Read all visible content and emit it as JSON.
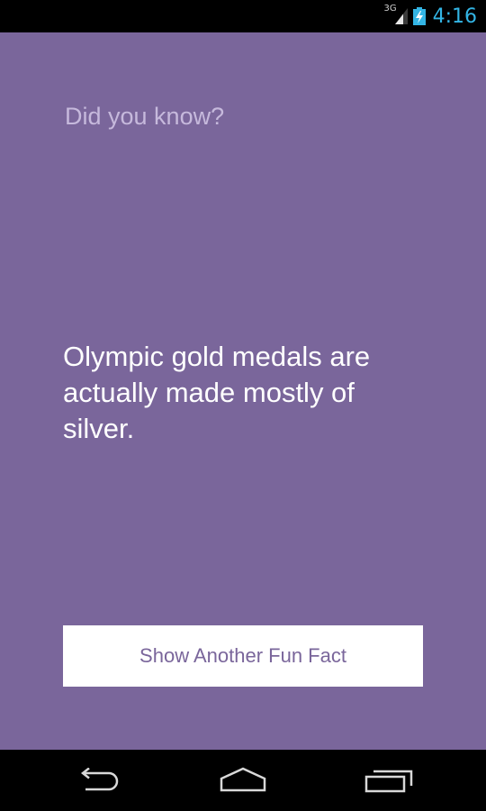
{
  "status_bar": {
    "network_type": "3G",
    "time": "4:16",
    "icons": [
      "signal-icon",
      "battery-charging-icon"
    ],
    "time_color": "#33b5e5"
  },
  "main": {
    "headline": "Did you know?",
    "fact_text": "Olympic gold medals are actually made mostly of silver.",
    "button_label": "Show Another Fun Fact"
  },
  "nav_bar": {
    "buttons": [
      "back-icon",
      "home-icon",
      "recent-apps-icon"
    ]
  },
  "colors": {
    "background": "#7a669b",
    "headline": "#c6b9dc",
    "fact_text": "#ffffff",
    "button_background": "#ffffff",
    "button_text": "#7a669b"
  }
}
